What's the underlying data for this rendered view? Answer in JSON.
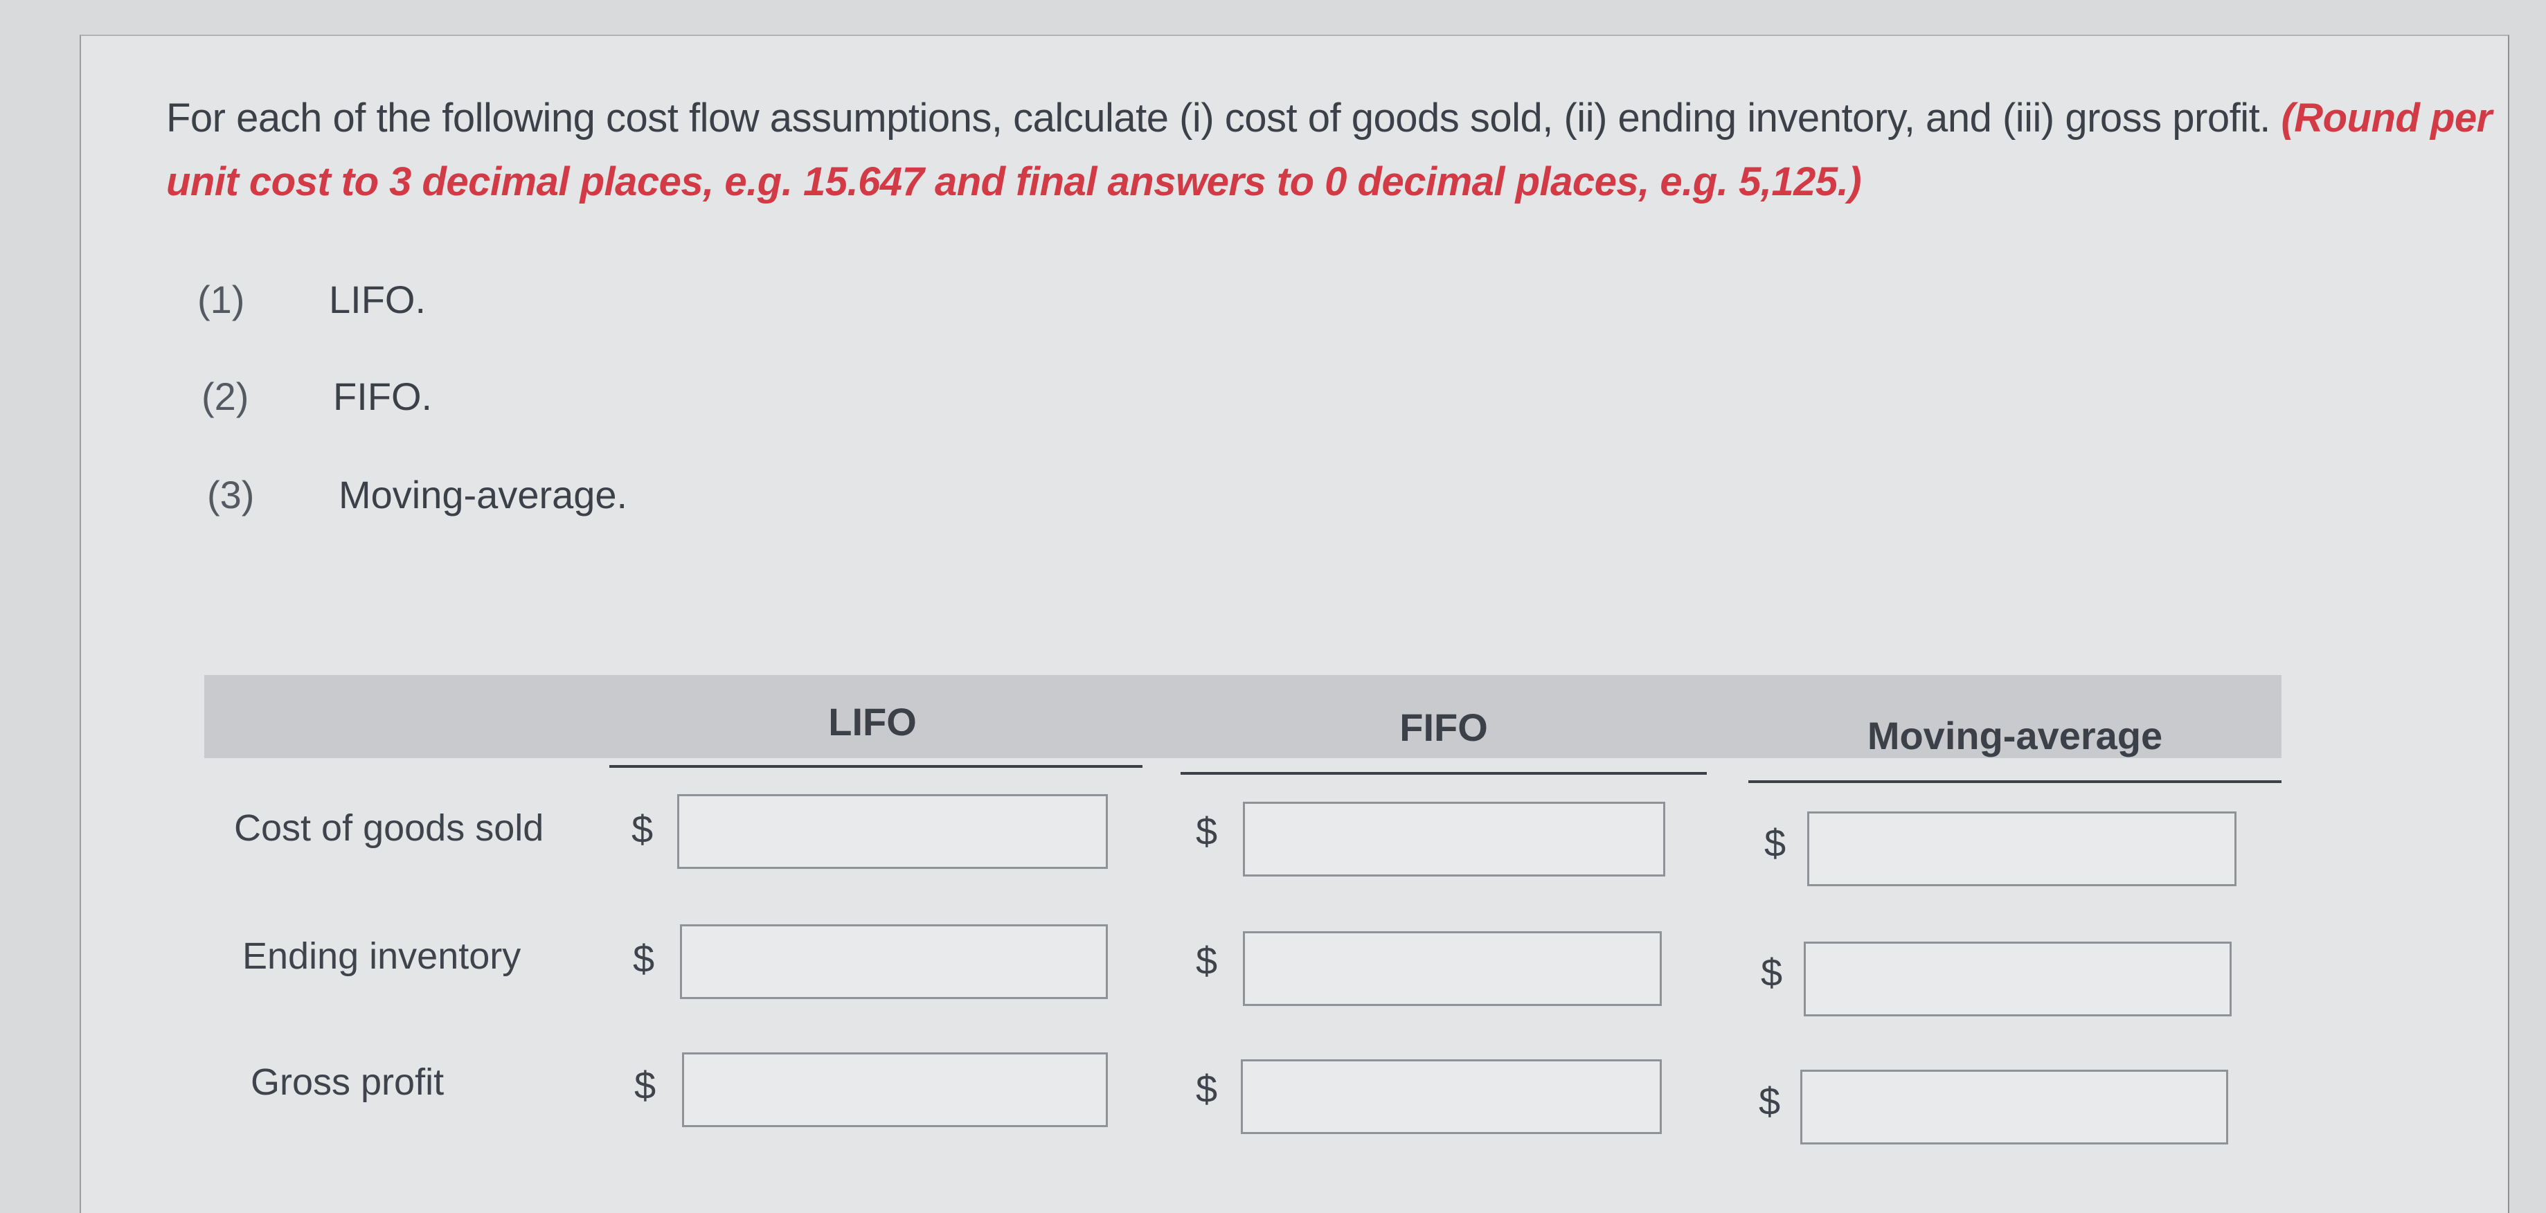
{
  "question": {
    "text": "For each of the following cost flow assumptions, calculate (i) cost of goods sold, (ii) ending inventory, and (iii) gross profit.",
    "instruction": "(Round per unit cost to 3 decimal places, e.g. 15.647 and final answers to 0 decimal places, e.g. 5,125.)"
  },
  "assumptions": [
    {
      "number": "(1)",
      "label": "LIFO."
    },
    {
      "number": "(2)",
      "label": "FIFO."
    },
    {
      "number": "(3)",
      "label": "Moving-average."
    }
  ],
  "table": {
    "columns": [
      "LIFO",
      "FIFO",
      "Moving-average"
    ],
    "rows": [
      {
        "label": "Cost of goods sold",
        "currency": "$",
        "values": [
          "",
          "",
          ""
        ]
      },
      {
        "label": "Ending inventory",
        "currency": "$",
        "values": [
          "",
          "",
          ""
        ]
      },
      {
        "label": "Gross profit",
        "currency": "$",
        "values": [
          "",
          "",
          ""
        ]
      }
    ]
  },
  "colors": {
    "instruction_red": "#d23a46",
    "text": "#3b4049",
    "header_band": "#c9cacd"
  }
}
